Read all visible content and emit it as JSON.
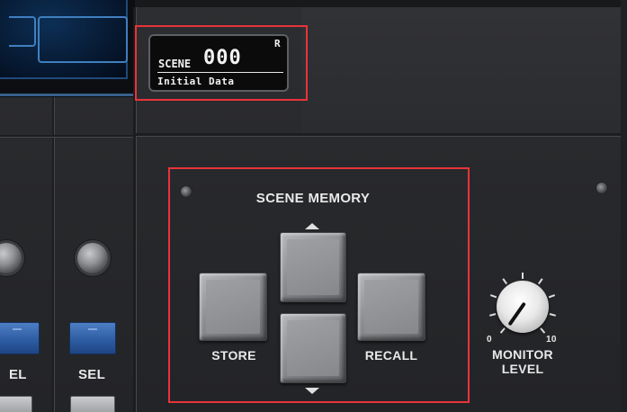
{
  "scene_display": {
    "label": "SCENE",
    "number": "000",
    "recall_flag": "R",
    "title": "Initial Data"
  },
  "scene_memory": {
    "section_label": "SCENE MEMORY",
    "store_label": "STORE",
    "recall_label": "RECALL"
  },
  "channel_strip": {
    "sel_label": "SEL",
    "sel_label_partial": "EL"
  },
  "monitor": {
    "scale_min": "0",
    "scale_max": "10",
    "label_line1": "MONITOR",
    "label_line2": "LEVEL"
  },
  "colors": {
    "panel": "#2a2b2e",
    "highlight": "#e8343a",
    "sel_button": "#2c5aa0",
    "lcd": "#06162c"
  }
}
